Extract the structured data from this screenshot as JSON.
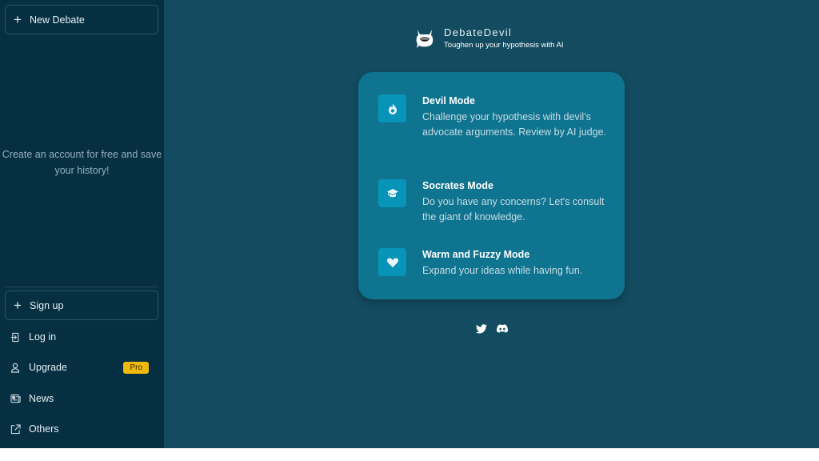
{
  "sidebar": {
    "new_debate_label": "New Debate",
    "account_message": "Create an account for free and save your history!",
    "signup_label": "Sign up",
    "items": [
      {
        "label": "Log in",
        "icon": "login-icon"
      },
      {
        "label": "Upgrade",
        "icon": "user-icon",
        "badge": "Pro"
      },
      {
        "label": "News",
        "icon": "newspaper-icon"
      },
      {
        "label": "Others",
        "icon": "external-link-icon"
      }
    ]
  },
  "header": {
    "app_name": "DebateDevil",
    "tagline": "Toughen up your hypothesis with AI"
  },
  "modes": [
    {
      "title": "Devil Mode",
      "description": "Challenge your hypothesis with devil's advocate arguments. Review by AI judge.",
      "icon": "flame-icon"
    },
    {
      "title": "Socrates Mode",
      "description": "Do you have any concerns? Let's consult the giant of knowledge.",
      "icon": "graduation-cap-icon"
    },
    {
      "title": "Warm and Fuzzy Mode",
      "description": "Expand your ideas while having fun.",
      "icon": "heart-icon"
    }
  ],
  "socials": [
    "twitter-icon",
    "discord-icon"
  ],
  "colors": {
    "sidebar_bg": "#063042",
    "main_bg": "#134c60",
    "card_bg": "#0f7490",
    "icon_tile": "#0894b8",
    "pro_badge": "#f2b90d"
  }
}
